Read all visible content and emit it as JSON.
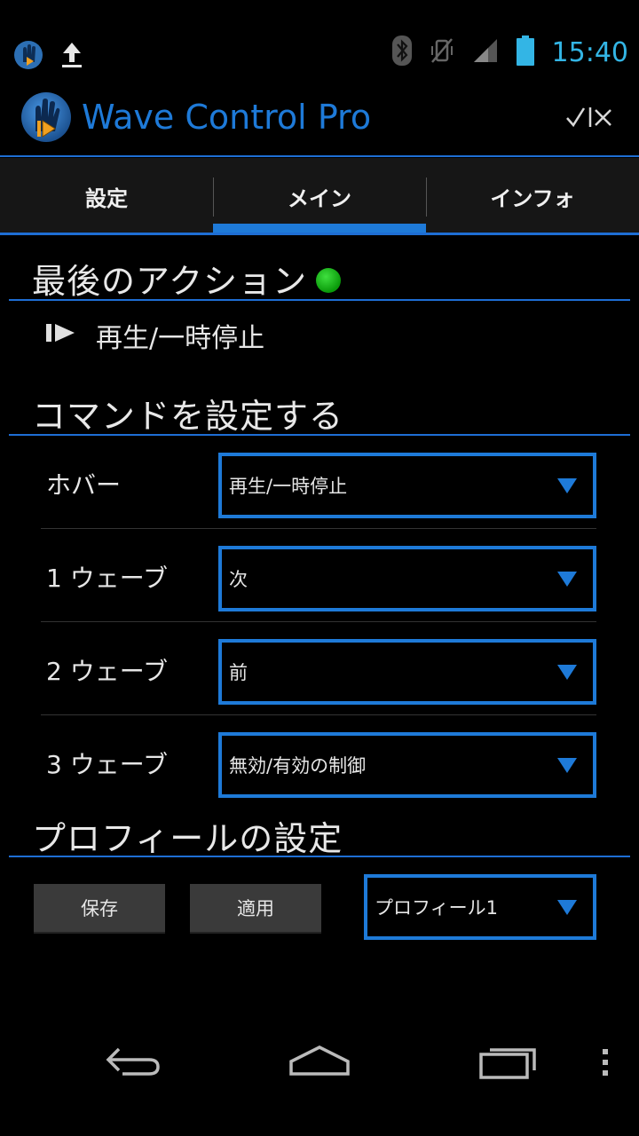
{
  "status_bar": {
    "time": "15:40",
    "left_icons": [
      "app-notification-icon",
      "upload-icon"
    ],
    "right_icons": [
      "bluetooth-icon",
      "vibrate-icon",
      "signal-icon",
      "battery-icon"
    ]
  },
  "app": {
    "title": "Wave Control Pro",
    "overflow_action": "✓|✕"
  },
  "tabs": [
    {
      "label": "設定",
      "active": false
    },
    {
      "label": "メイン",
      "active": true
    },
    {
      "label": "インフォ",
      "active": false
    }
  ],
  "last_action": {
    "heading": "最後のアクション",
    "value": "再生/一時停止"
  },
  "commands": {
    "heading": "コマンドを設定する",
    "rows": [
      {
        "label": "ホバー",
        "value": "再生/一時停止"
      },
      {
        "label": "1 ウェーブ",
        "value": "次"
      },
      {
        "label": "2 ウェーブ",
        "value": "前"
      },
      {
        "label": "3 ウェーブ",
        "value": "無効/有効の制御"
      }
    ]
  },
  "profile": {
    "heading": "プロフィールの設定",
    "save_label": "保存",
    "apply_label": "適用",
    "selected": "プロフィール1"
  },
  "colors": {
    "accent": "#1e7ad8",
    "status_ok": "#1fbf1f",
    "clock": "#33b5e5"
  }
}
